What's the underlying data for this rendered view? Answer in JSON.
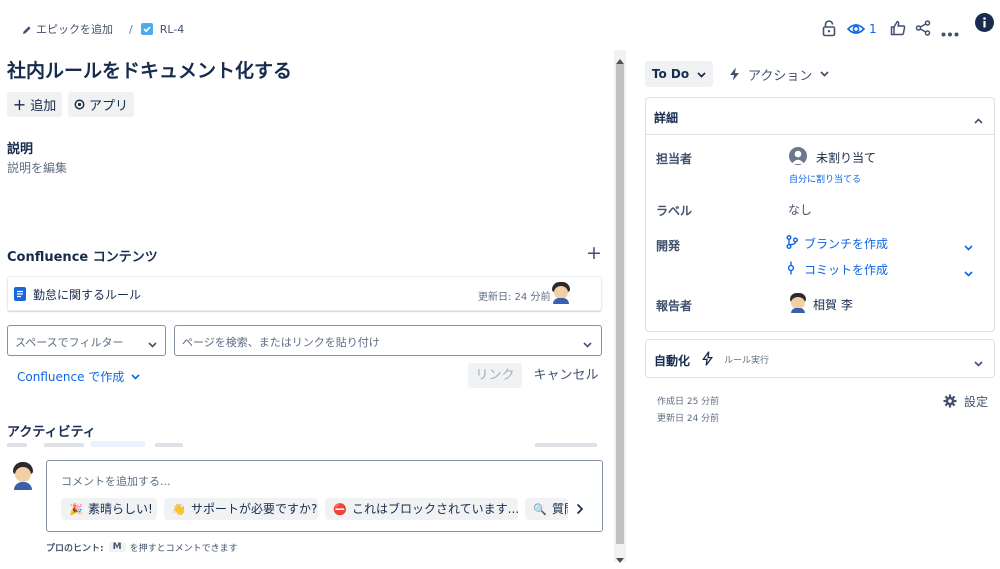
{
  "breadcrumb": {
    "add_epic": "エピックを追加",
    "separator": "/",
    "issue_key": "RL-4"
  },
  "header": {
    "watch_count": "1"
  },
  "issue": {
    "title": "社内ルールをドキュメント化する"
  },
  "toolbar": {
    "add_label": "追加",
    "apps_label": "アプリ"
  },
  "description": {
    "heading": "説明",
    "placeholder": "説明を編集"
  },
  "confluence": {
    "heading": "Confluence コンテンツ",
    "page_title": "勤怠に関するルール",
    "updated": "更新日: 24 分前",
    "space_filter": "スペースでフィルター",
    "search_placeholder": "ページを検索、またはリンクを貼り付け",
    "create_label": "Confluence で作成",
    "link_button": "リンク",
    "cancel_button": "キャンセル"
  },
  "activity": {
    "heading": "アクティビティ",
    "comment_placeholder": "コメントを追加する...",
    "chips": [
      {
        "emoji": "🎉",
        "label": "素晴らしい!"
      },
      {
        "emoji": "👋",
        "label": "サポートが必要ですか?"
      },
      {
        "emoji": "⛔",
        "label": "これはブロックされています..."
      },
      {
        "emoji": "🔍",
        "label": "質問"
      }
    ],
    "tip_prefix": "プロのヒント:",
    "tip_key": "M",
    "tip_suffix": "を押すとコメントできます"
  },
  "status": {
    "label": "To Do",
    "actions_label": "アクション"
  },
  "details": {
    "heading": "詳細",
    "assignee_label": "担当者",
    "assignee_value": "未割り当て",
    "assign_self": "自分に割り当てる",
    "labels_label": "ラベル",
    "labels_value": "なし",
    "dev_label": "開発",
    "create_branch": "ブランチを作成",
    "create_commit": "コミットを作成",
    "reporter_label": "報告者",
    "reporter_name": "相賀 李"
  },
  "automation": {
    "heading": "自動化",
    "rule_runs": "ルール実行"
  },
  "meta": {
    "created": "作成日 25 分前",
    "updated": "更新日 24 分前",
    "settings": "設定"
  },
  "colors": {
    "link": "#0c66e4",
    "text": "#172b4d",
    "muted": "#5e6c84",
    "border": "#dfe1e6"
  }
}
